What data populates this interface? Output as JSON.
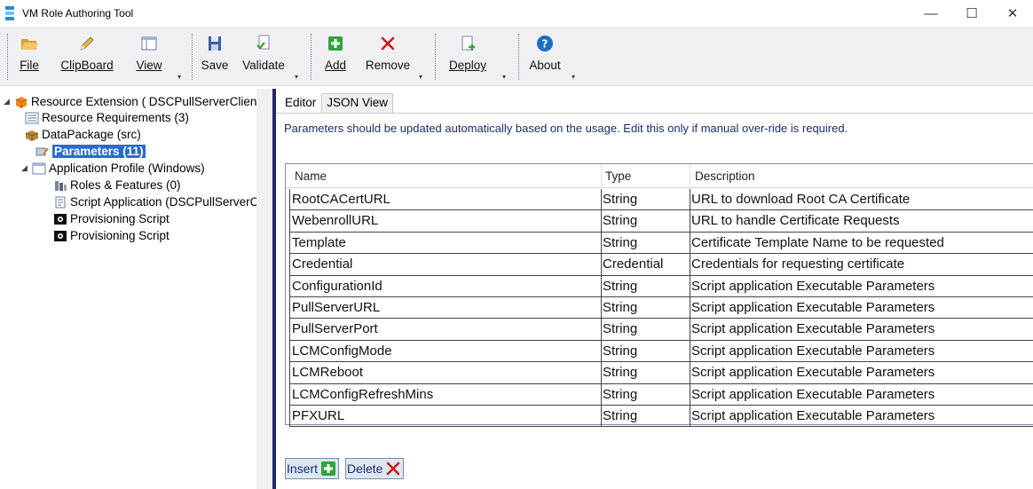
{
  "window": {
    "title": "VM Role Authoring Tool",
    "minimize_glyph": "—",
    "maximize_glyph": "☐",
    "close_glyph": "✕"
  },
  "ribbon": {
    "file": "File",
    "clipboard": "ClipBoard",
    "view": "View",
    "save": "Save",
    "validate": "Validate",
    "add": "Add",
    "remove": "Remove",
    "deploy": "Deploy",
    "about": "About",
    "dropdown_glyph": "▾"
  },
  "tree": {
    "expand_open": "◢",
    "expand_closed": "▷",
    "items": [
      {
        "label": "Resource Extension ( DSCPullServerClien",
        "icon": "box-icon"
      },
      {
        "label": "Resource Requirements (3)",
        "icon": "list-icon"
      },
      {
        "label": "DataPackage (src)",
        "icon": "package-icon"
      },
      {
        "label": "Parameters (11)",
        "icon": "parameters-icon"
      },
      {
        "label": "Application Profile (Windows)",
        "icon": "window-icon"
      },
      {
        "label": "Roles & Features (0)",
        "icon": "server-icon"
      },
      {
        "label": "Script Application (DSCPullServerC",
        "icon": "script-icon"
      },
      {
        "label": "Provisioning Script",
        "icon": "console-icon"
      },
      {
        "label": "Provisioning Script",
        "icon": "console-icon"
      }
    ]
  },
  "editor": {
    "tabs": [
      "Editor",
      "JSON View"
    ],
    "info": "Parameters should be updated automatically based on the usage. Edit this only if manual over-ride is required.",
    "columns": [
      "Name",
      "Type",
      "Description"
    ],
    "rows": [
      {
        "name": "RootCACertURL",
        "type": "String",
        "description": "URL to download Root CA Certificate"
      },
      {
        "name": "WebenrollURL",
        "type": "String",
        "description": "URL to handle Certificate Requests"
      },
      {
        "name": "Template",
        "type": "String",
        "description": "Certificate Template Name to be requested"
      },
      {
        "name": "Credential",
        "type": "Credential",
        "description": "Credentials for requesting certificate"
      },
      {
        "name": "ConfigurationId",
        "type": "String",
        "description": "Script application Executable Parameters"
      },
      {
        "name": "PullServerURL",
        "type": "String",
        "description": "Script application Executable Parameters"
      },
      {
        "name": "PullServerPort",
        "type": "String",
        "description": "Script application Executable Parameters"
      },
      {
        "name": "LCMConfigMode",
        "type": "String",
        "description": "Script application Executable Parameters"
      },
      {
        "name": "LCMReboot",
        "type": "String",
        "description": "Script application Executable Parameters"
      },
      {
        "name": "LCMConfigRefreshMins",
        "type": "String",
        "description": "Script application Executable Parameters"
      },
      {
        "name": "PFXURL",
        "type": "String",
        "description": "Script application Executable Parameters"
      }
    ],
    "insert": "Insert",
    "delete": "Delete"
  },
  "colors": {
    "accent": "#2a6bd0",
    "info_text": "#1b2d6b",
    "splitter": "#1e2a6e",
    "ribbon_bg": "#f0f0f4"
  }
}
